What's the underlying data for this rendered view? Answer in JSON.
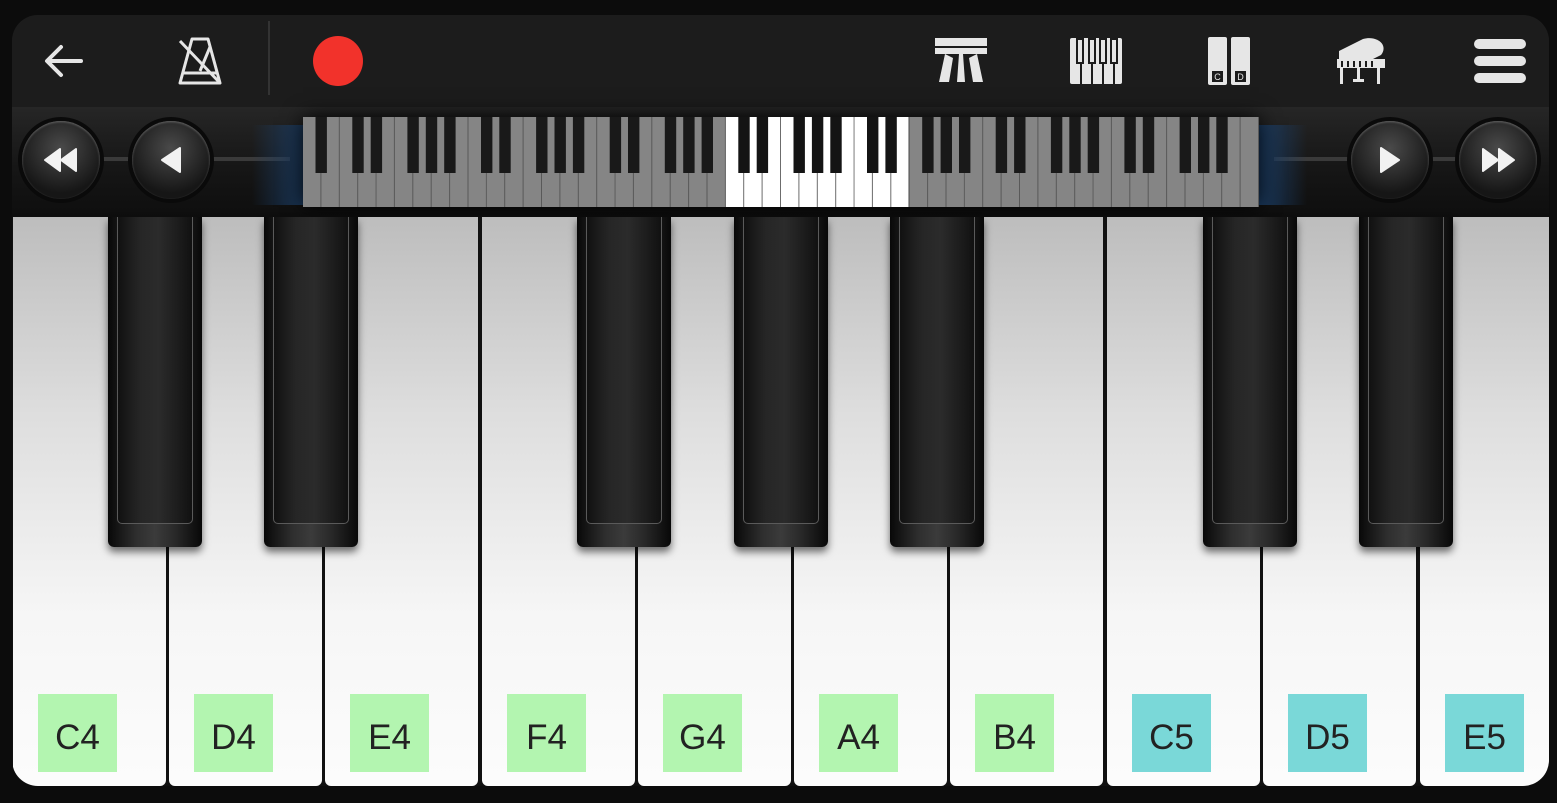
{
  "toolbar": {
    "back_icon": "arrow-left-icon",
    "metronome_icon": "metronome-off-icon",
    "record_color": "#f2322b",
    "buttons": [
      "two-row-keyboard-icon",
      "keyboard-icon",
      "key-labels-icon",
      "grand-piano-icon",
      "menu-icon"
    ],
    "key_labels_icon_letters": [
      "C",
      "D"
    ]
  },
  "navigator": {
    "buttons": [
      "fast-rewind-icon",
      "previous-icon",
      "next-icon",
      "fast-forward-icon"
    ]
  },
  "keyboard": {
    "white_keys": [
      {
        "label": "C4",
        "color": "#b3f5b0"
      },
      {
        "label": "D4",
        "color": "#b3f5b0"
      },
      {
        "label": "E4",
        "color": "#b3f5b0"
      },
      {
        "label": "F4",
        "color": "#b3f5b0"
      },
      {
        "label": "G4",
        "color": "#b3f5b0"
      },
      {
        "label": "A4",
        "color": "#b3f5b0"
      },
      {
        "label": "B4",
        "color": "#b3f5b0"
      },
      {
        "label": "C5",
        "color": "#7ad8d8"
      },
      {
        "label": "D5",
        "color": "#7ad8d8"
      },
      {
        "label": "E5",
        "color": "#7ad8d8"
      }
    ]
  }
}
